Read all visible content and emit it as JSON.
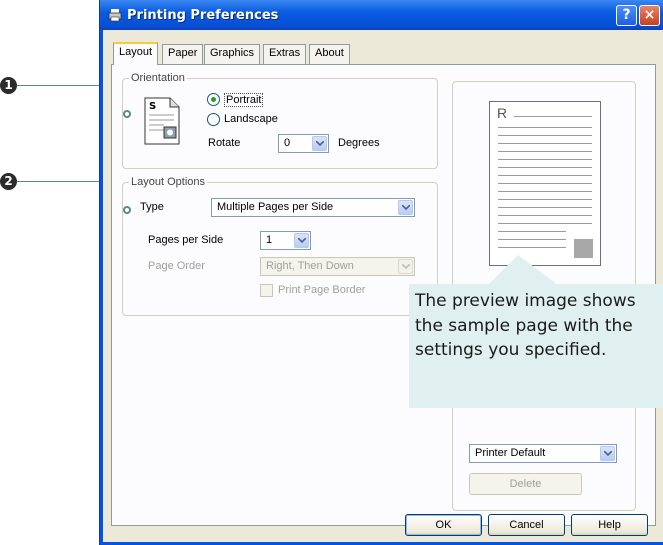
{
  "window": {
    "title": "Printing Preferences",
    "help_btn": "?",
    "close_btn": "×"
  },
  "tabs": [
    {
      "label": "Layout",
      "active": true
    },
    {
      "label": "Paper"
    },
    {
      "label": "Graphics"
    },
    {
      "label": "Extras"
    },
    {
      "label": "About"
    }
  ],
  "callouts": [
    "1",
    "2"
  ],
  "orientation": {
    "group_label": "Orientation",
    "icon": "portrait-page-icon",
    "portrait_label": "Portrait",
    "landscape_label": "Landscape",
    "selected": "Portrait",
    "rotate_label": "Rotate",
    "rotate_value": "0",
    "degrees_label": "Degrees"
  },
  "layout_options": {
    "group_label": "Layout Options",
    "type_label": "Type",
    "type_value": "Multiple Pages per Side",
    "pages_per_side_label": "Pages per Side",
    "pages_per_side_value": "1",
    "page_order_label": "Page Order",
    "page_order_value": "Right, Then Down",
    "print_border_label": "Print Page Border"
  },
  "preview": {
    "page_letter": "R",
    "favorites_value": "Printer Default",
    "delete_label": "Delete"
  },
  "tooltip": {
    "text": "The preview image shows the sample page with the settings you specified."
  },
  "footer": {
    "ok_label": "OK",
    "cancel_label": "Cancel",
    "help_label": "Help"
  }
}
